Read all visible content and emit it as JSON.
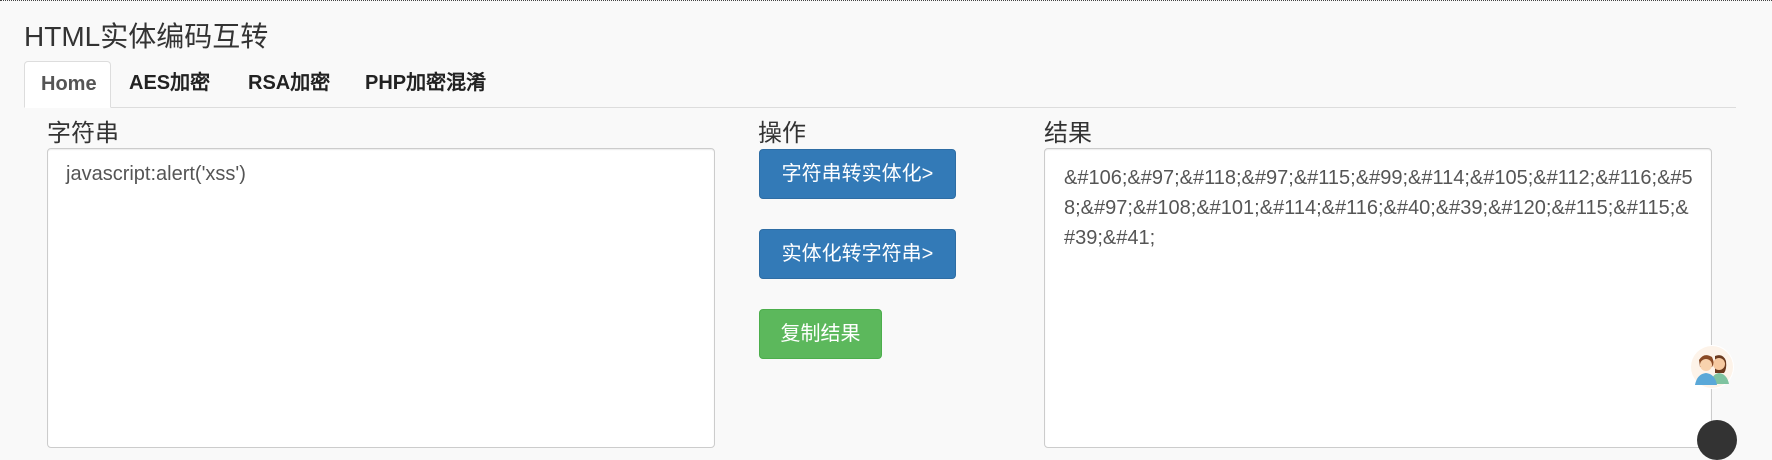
{
  "page": {
    "title": "HTML实体编码互转"
  },
  "tabs": [
    {
      "label": "Home",
      "active": true
    },
    {
      "label": "AES加密",
      "active": false
    },
    {
      "label": "RSA加密",
      "active": false
    },
    {
      "label": "PHP加密混淆",
      "active": false
    }
  ],
  "input": {
    "label": "字符串",
    "value": "javascript:alert('xss')"
  },
  "actions": {
    "label": "操作",
    "to_entity": "字符串转实体化>",
    "to_string": "实体化转字符串>",
    "copy": "复制结果"
  },
  "result": {
    "label": "结果",
    "value": "&#106;&#97;&#118;&#97;&#115;&#99;&#114;&#105;&#112;&#116;&#58;&#97;&#108;&#101;&#114;&#116;&#40;&#39;&#120;&#115;&#115;&#39;&#41;"
  },
  "colors": {
    "primary": "#337ab7",
    "success": "#5cb85c",
    "background": "#f9f9f9"
  },
  "icons": {
    "floating_contact": "users-avatar-icon"
  }
}
